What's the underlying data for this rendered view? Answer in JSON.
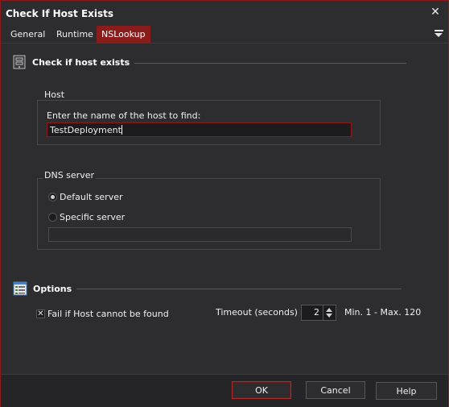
{
  "window": {
    "title": "Check If Host Exists",
    "close_glyph": "✕"
  },
  "tabs": [
    {
      "label": "General",
      "active": false
    },
    {
      "label": "Runtime",
      "active": false
    },
    {
      "label": "NSLookup",
      "active": true
    }
  ],
  "section_main": {
    "title": "Check if host exists",
    "icon": "server-icon"
  },
  "host_group": {
    "label": "Host",
    "prompt": "Enter the name of the host to find:",
    "value": "TestDeployment"
  },
  "dns_group": {
    "label": "DNS server",
    "options": [
      {
        "label": "Default server",
        "checked": true
      },
      {
        "label": "Specific server",
        "checked": false
      }
    ],
    "specific_value": ""
  },
  "section_options": {
    "title": "Options",
    "icon": "options-list-icon"
  },
  "options": {
    "fail_label": "Fail if Host cannot be found",
    "fail_checked": true,
    "timeout_label": "Timeout (seconds)",
    "timeout_value": "2",
    "timeout_range": "Min. 1 - Max. 120"
  },
  "footer": {
    "ok_label": "OK",
    "cancel_label": "Cancel",
    "help_label": "Help"
  },
  "colors": {
    "accent": "#8a1c1c",
    "background": "#2d2d30"
  }
}
